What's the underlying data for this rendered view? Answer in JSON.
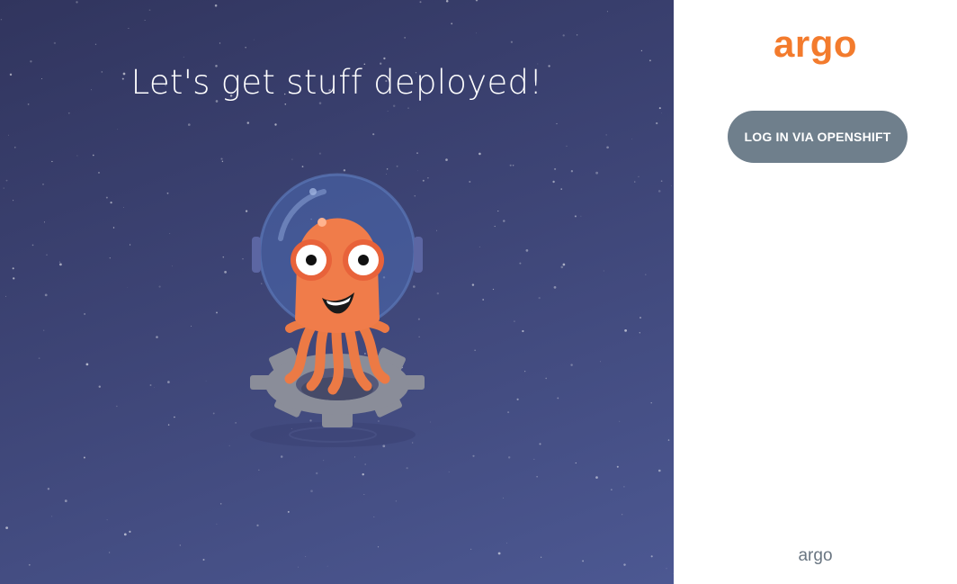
{
  "hero": {
    "title": "Let's get stuff deployed!",
    "mascot_icon": "astronaut-octopus-icon",
    "background_colors": [
      "#31355e",
      "#4c5892"
    ]
  },
  "login": {
    "brand": "argo",
    "brand_color": "#f37b2d",
    "button_label": "LOG IN VIA OPENSHIFT",
    "button_color": "#6f7f8c",
    "footer_brand": "argo"
  }
}
